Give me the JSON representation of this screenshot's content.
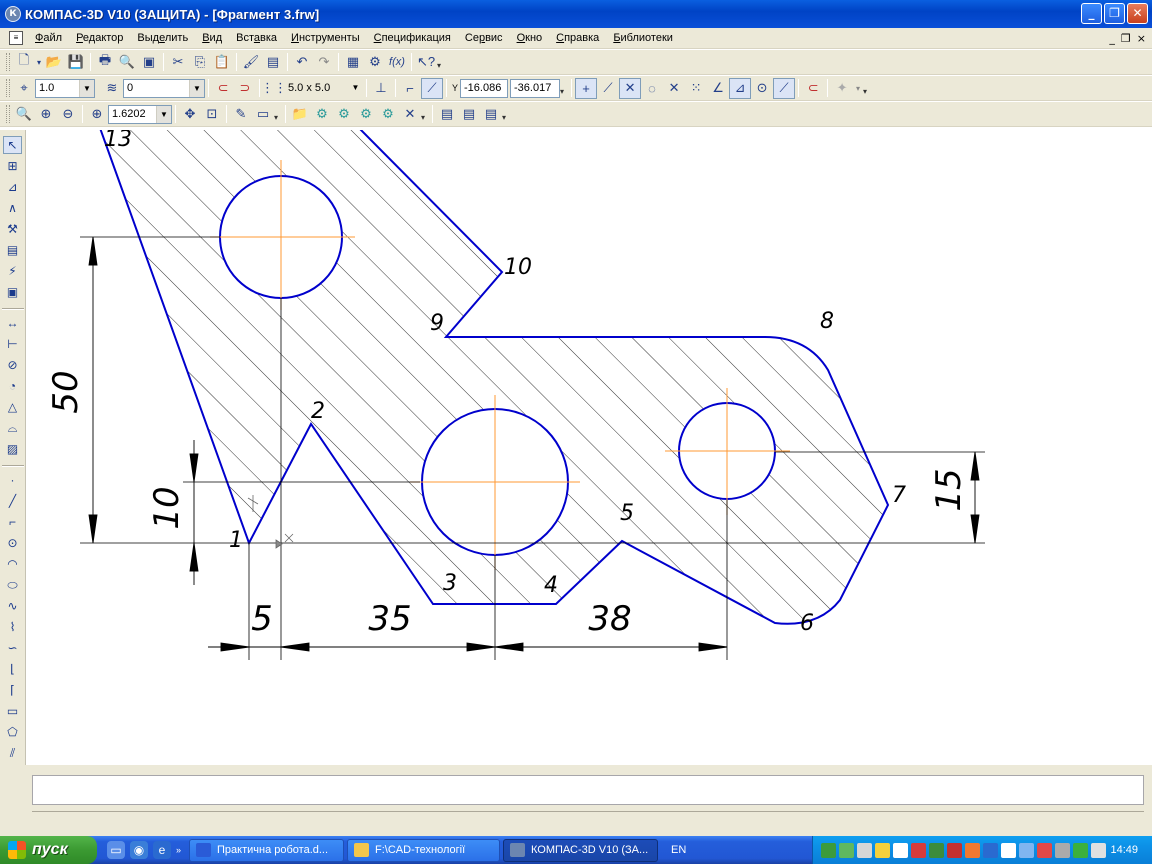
{
  "window": {
    "title": "КОМПАС-3D V10 (ЗАЩИТА) - [Фрагмент 3.frw]",
    "app_icon_letter": "К",
    "controls": {
      "minimize": "_",
      "maximize": "❐",
      "close": "✕"
    }
  },
  "menubar": {
    "items": [
      {
        "id": "file",
        "pre": "",
        "u": "Ф",
        "post": "айл"
      },
      {
        "id": "edit",
        "pre": "",
        "u": "Р",
        "post": "едактор"
      },
      {
        "id": "select",
        "pre": "Выд",
        "u": "е",
        "post": "лить"
      },
      {
        "id": "view",
        "pre": "",
        "u": "В",
        "post": "ид"
      },
      {
        "id": "insert",
        "pre": "Вст",
        "u": "а",
        "post": "вка"
      },
      {
        "id": "tools",
        "pre": "",
        "u": "И",
        "post": "нструменты"
      },
      {
        "id": "spec",
        "pre": "",
        "u": "С",
        "post": "пецификация"
      },
      {
        "id": "service",
        "pre": "Се",
        "u": "р",
        "post": "вис"
      },
      {
        "id": "window",
        "pre": "",
        "u": "О",
        "post": "кно"
      },
      {
        "id": "help",
        "pre": "",
        "u": "С",
        "post": "правка"
      },
      {
        "id": "libs",
        "pre": "",
        "u": "Б",
        "post": "иблиотеки"
      }
    ],
    "mdi_controls": {
      "minimize": "_",
      "restore": "❐",
      "close": "×"
    }
  },
  "toolbar_props": {
    "style_value": "1.0",
    "layer_value": "0",
    "grid_step": "5.0 x 5.0",
    "x_coord": "-16.086",
    "y_coord": "-36.017",
    "axis_label": "Y"
  },
  "toolbar_view": {
    "zoom_value": "1.6202"
  },
  "drawing": {
    "colors": {
      "contour": "#0000cc",
      "axis": "#ff9933",
      "dim": "#000000",
      "hatch": "#000000"
    },
    "point_labels": [
      "1",
      "2",
      "3",
      "4",
      "5",
      "6",
      "7",
      "8",
      "9",
      "10",
      "13"
    ],
    "dimensions": {
      "d50": "50",
      "d10": "10",
      "d15": "15",
      "d5": "5",
      "d35": "35",
      "d38": "38"
    }
  },
  "taskbar": {
    "start_label": "пуск",
    "tasks": [
      {
        "label": "Практична робота.d...",
        "color": "#2a5bd7",
        "active": false
      },
      {
        "label": "F:\\CAD-технології",
        "color": "#f3c64b",
        "active": false
      },
      {
        "label": "КОМПАС-3D V10 (ЗА...",
        "color": "#6c86b0",
        "active": true
      }
    ],
    "language": "EN",
    "clock": "14:49"
  }
}
